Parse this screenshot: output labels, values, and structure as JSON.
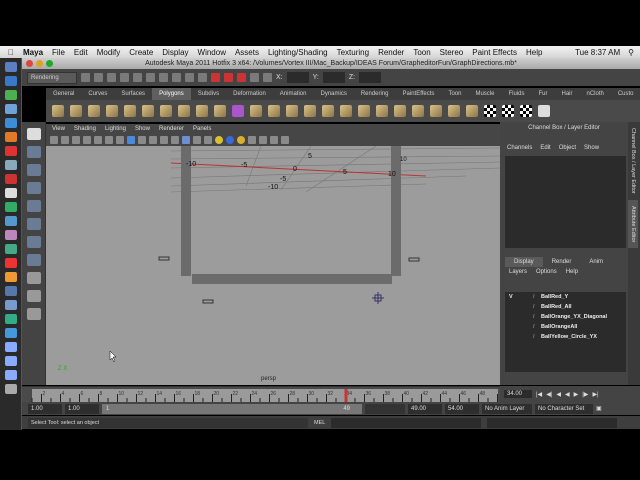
{
  "menubar": {
    "items": [
      "Maya",
      "File",
      "Edit",
      "Modify",
      "Create",
      "Display",
      "Window",
      "Assets",
      "Lighting/Shading",
      "Texturing",
      "Render",
      "Toon",
      "Stereo",
      "Paint Effects",
      "Help"
    ],
    "clock": "Tue 8:37 AM"
  },
  "window": {
    "title": "Autodesk Maya 2011 Hotfix 3 x64: /Volumes/Vortex III/Mac_Backup/IDEAS Forum/GrapheditorFun/GraphDirections.mb*"
  },
  "statusline": {
    "menuset": "Rendering",
    "x_label": "X:",
    "y_label": "Y:",
    "z_label": "Z:"
  },
  "shelf": {
    "tabs": [
      "General",
      "Curves",
      "Surfaces",
      "Polygons",
      "Subdivs",
      "Deformation",
      "Animation",
      "Dynamics",
      "Rendering",
      "PaintEffects",
      "Toon",
      "Muscle",
      "Fluids",
      "Fur",
      "Hair",
      "nCloth",
      "Custo"
    ],
    "active": "Polygons"
  },
  "viewport": {
    "menu": [
      "View",
      "Shading",
      "Lighting",
      "Show",
      "Renderer",
      "Panels"
    ],
    "camera": "persp",
    "axis": "Z X",
    "grid_labels": [
      "-10",
      "-5",
      "0",
      "5",
      "10",
      "-5",
      "-10",
      "5",
      "10"
    ]
  },
  "channelbox": {
    "title": "Channel Box / Layer Editor",
    "menu": [
      "Channels",
      "Edit",
      "Object",
      "Show"
    ],
    "layer_tabs": [
      "Display",
      "Render",
      "Anim"
    ],
    "layer_menu": [
      "Layers",
      "Options",
      "Help"
    ],
    "layers": [
      {
        "visible": "V",
        "name": "BallRed_Y"
      },
      {
        "visible": "",
        "name": "BallRed_All"
      },
      {
        "visible": "",
        "name": "BallOrange_YX_Diagonal"
      },
      {
        "visible": "",
        "name": "BallOrangeAll"
      },
      {
        "visible": "",
        "name": "BallYellow_Circle_YX"
      }
    ]
  },
  "sidetabs": [
    "Channel Box / Layer Editor",
    "Attribute Editor"
  ],
  "timeline": {
    "ticks": [
      "2",
      "4",
      "6",
      "8",
      "10",
      "12",
      "14",
      "16",
      "18",
      "20",
      "22",
      "24",
      "26",
      "28",
      "30",
      "32",
      "34",
      "36",
      "38",
      "40",
      "42",
      "44",
      "46",
      "48"
    ],
    "current": "34.00"
  },
  "range": {
    "start": "1.00",
    "playback_start": "1.00",
    "slider_start": "1",
    "slider_end": "49",
    "playback_end": "49.00",
    "end": "54.00",
    "anim_layer": "No Anim Layer",
    "character_set": "No Character Set"
  },
  "helpline": {
    "text": "Select Tool: select an object",
    "mel_label": "MEL"
  }
}
